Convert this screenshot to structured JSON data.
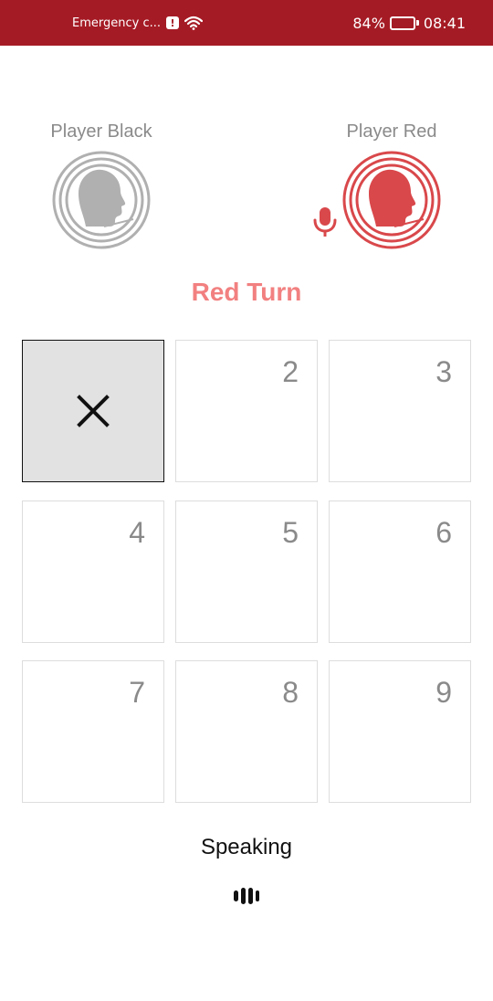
{
  "status_bar": {
    "carrier_text": "Emergency c...",
    "battery_percent": "84%",
    "battery_level": 0.84,
    "time": "08:41",
    "icons": [
      "alert-icon",
      "wifi-icon",
      "battery-icon"
    ]
  },
  "players": {
    "black": {
      "label": "Player Black",
      "color": "#b0b0b0"
    },
    "red": {
      "label": "Player Red",
      "color": "#d9484b",
      "active": true
    }
  },
  "turn": {
    "text": "Red Turn",
    "color": "#f28080"
  },
  "board": {
    "cells": [
      {
        "number": "",
        "mark": "X"
      },
      {
        "number": "2",
        "mark": ""
      },
      {
        "number": "3",
        "mark": ""
      },
      {
        "number": "4",
        "mark": ""
      },
      {
        "number": "5",
        "mark": ""
      },
      {
        "number": "6",
        "mark": ""
      },
      {
        "number": "7",
        "mark": ""
      },
      {
        "number": "8",
        "mark": ""
      },
      {
        "number": "9",
        "mark": ""
      }
    ]
  },
  "voice": {
    "status": "Speaking"
  }
}
